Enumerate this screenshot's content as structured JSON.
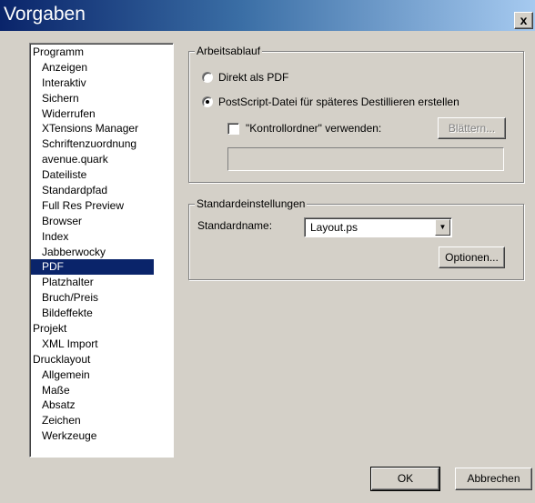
{
  "window": {
    "title": "Vorgaben",
    "close_label": "x"
  },
  "sidebar": {
    "items": [
      {
        "label": "Programm",
        "level": 0,
        "selected": false
      },
      {
        "label": "Anzeigen",
        "level": 1,
        "selected": false
      },
      {
        "label": "Interaktiv",
        "level": 1,
        "selected": false
      },
      {
        "label": "Sichern",
        "level": 1,
        "selected": false
      },
      {
        "label": "Widerrufen",
        "level": 1,
        "selected": false
      },
      {
        "label": "XTensions Manager",
        "level": 1,
        "selected": false
      },
      {
        "label": "Schriftenzuordnung",
        "level": 1,
        "selected": false
      },
      {
        "label": "avenue.quark",
        "level": 1,
        "selected": false
      },
      {
        "label": "Dateiliste",
        "level": 1,
        "selected": false
      },
      {
        "label": "Standardpfad",
        "level": 1,
        "selected": false
      },
      {
        "label": "Full Res Preview",
        "level": 1,
        "selected": false
      },
      {
        "label": "Browser",
        "level": 1,
        "selected": false
      },
      {
        "label": "Index",
        "level": 1,
        "selected": false
      },
      {
        "label": "Jabberwocky",
        "level": 1,
        "selected": false
      },
      {
        "label": "PDF",
        "level": 1,
        "selected": true
      },
      {
        "label": "Platzhalter",
        "level": 1,
        "selected": false
      },
      {
        "label": "Bruch/Preis",
        "level": 1,
        "selected": false
      },
      {
        "label": "Bildeffekte",
        "level": 1,
        "selected": false
      },
      {
        "label": "Projekt",
        "level": 0,
        "selected": false
      },
      {
        "label": "XML Import",
        "level": 1,
        "selected": false
      },
      {
        "label": "Drucklayout",
        "level": 0,
        "selected": false
      },
      {
        "label": "Allgemein",
        "level": 1,
        "selected": false
      },
      {
        "label": "Maße",
        "level": 1,
        "selected": false
      },
      {
        "label": "Absatz",
        "level": 1,
        "selected": false
      },
      {
        "label": "Zeichen",
        "level": 1,
        "selected": false
      },
      {
        "label": "Werkzeuge",
        "level": 1,
        "selected": false
      }
    ],
    "scroll_up_icon": "triangle-up-icon",
    "scroll_down_icon": "triangle-down-icon"
  },
  "workflow": {
    "legend": "Arbeitsablauf",
    "direct_pdf_label": "Direkt als PDF",
    "direct_pdf_selected": false,
    "postscript_label": "PostScript-Datei für späteres Destillieren erstellen",
    "postscript_selected": true,
    "watch_folder_label": "\"Kontrollordner\" verwenden:",
    "watch_folder_checked": false,
    "browse_label": "Blättern...",
    "watch_folder_path": ""
  },
  "defaults": {
    "legend": "Standardeinstellungen",
    "name_label": "Standardname:",
    "name_value": "Layout.ps",
    "options_label": "Optionen..."
  },
  "footer": {
    "ok_label": "OK",
    "cancel_label": "Abbrechen"
  }
}
